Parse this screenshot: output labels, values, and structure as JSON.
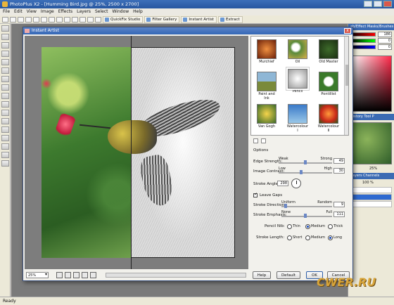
{
  "window": {
    "title": "PhotoPlus X2 - [Humming Bird.jpg @ 25%, 2500 x 2700]"
  },
  "menu": [
    "File",
    "Edit",
    "View",
    "Image",
    "Effects",
    "Layers",
    "Select",
    "Window",
    "Help"
  ],
  "toolbar": {
    "quickfix": "QuickFix Studio",
    "filtergallery": "Filter Gallery",
    "instantartist": "Instant Artist",
    "extract": "Extract"
  },
  "right_panels": {
    "head1": "ab/Effect Masks/Brushes",
    "values": [
      "186",
      "0",
      "0"
    ],
    "head2": "History Tool P",
    "nav_zoom": "25%",
    "head3": "Layers Channels",
    "opacity": "100 %"
  },
  "status": "Ready",
  "dialog": {
    "title": "Instant Artist",
    "close": "x",
    "thumbnails": [
      {
        "label": "Murchief",
        "color": "#b8481a"
      },
      {
        "label": "Oil",
        "color": "#d9b04a"
      },
      {
        "label": "Old Master",
        "color": "#a0582a"
      },
      {
        "label": "Paint and Ink",
        "color": "#6b8a9a"
      },
      {
        "label": "Pencil",
        "color": "#dddddd"
      },
      {
        "label": "Pontillist",
        "color": "#7aa84a"
      },
      {
        "label": "Van Gogh",
        "color": "#c9a53a"
      },
      {
        "label": "Watercolour I",
        "color": "#4a8ac8"
      },
      {
        "label": "Watercolour II",
        "color": "#d85a2a"
      }
    ],
    "options_title": "Options",
    "edge_strength": {
      "label": "Edge Strength:",
      "min": "Weak",
      "max": "Strong",
      "value": "49"
    },
    "image_contrast": {
      "label": "Image Contrast:",
      "min": "Low",
      "max": "High",
      "value": "30"
    },
    "stroke_angle": {
      "label": "Stroke Angle:",
      "value": "298"
    },
    "leave_gaps": {
      "label": "Leave Gaps",
      "checked": true
    },
    "stroke_direction": {
      "label": "Stroke Direction:",
      "min": "Uniform",
      "max": "Random",
      "value": "9"
    },
    "stroke_emphasis": {
      "label": "Stroke Emphasis:",
      "min": "None",
      "max": "Full",
      "value": "111"
    },
    "pencil_nib": {
      "label": "Pencil Nib:",
      "options": [
        "Thin",
        "Medium",
        "Thick"
      ],
      "selected": "Medium"
    },
    "stroke_length": {
      "label": "Stroke Length:",
      "options": [
        "Short",
        "Medium",
        "Long"
      ],
      "selected": "Long"
    },
    "zoom": "25%",
    "buttons": {
      "help": "Help",
      "default": "Default",
      "ok": "OK",
      "cancel": "Cancel"
    }
  },
  "watermark": "CWER.RU"
}
